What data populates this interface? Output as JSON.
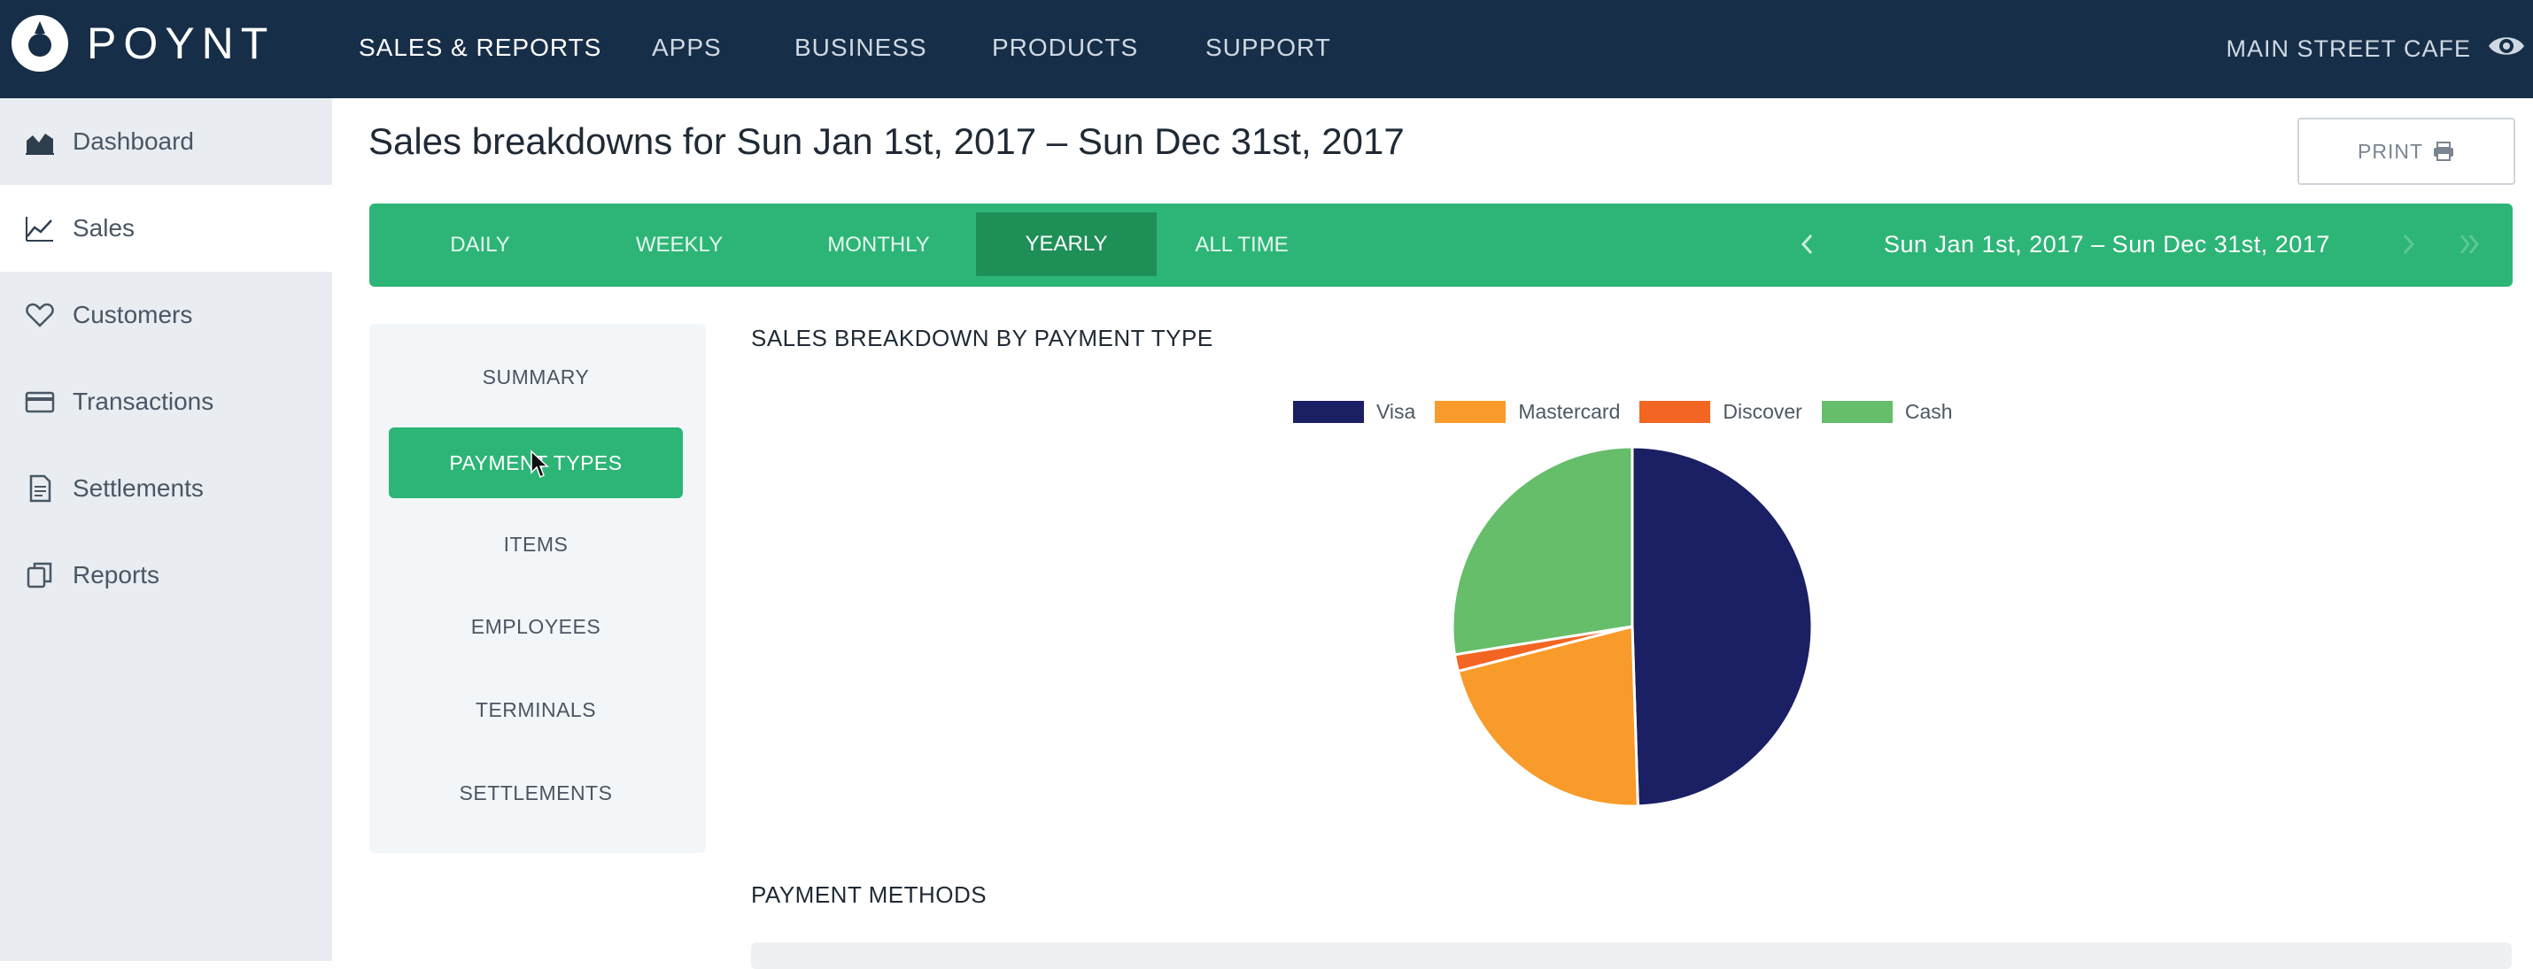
{
  "brand": {
    "name": "POYNT"
  },
  "nav": {
    "items": [
      {
        "label": "SALES & REPORTS",
        "active": true
      },
      {
        "label": "APPS"
      },
      {
        "label": "BUSINESS"
      },
      {
        "label": "PRODUCTS"
      },
      {
        "label": "SUPPORT"
      }
    ],
    "store_name": "MAIN STREET CAFE"
  },
  "sidebar": {
    "items": [
      {
        "label": "Dashboard",
        "icon": "area-chart-icon"
      },
      {
        "label": "Sales",
        "icon": "line-chart-icon",
        "active": true
      },
      {
        "label": "Customers",
        "icon": "heart-icon"
      },
      {
        "label": "Transactions",
        "icon": "credit-card-icon"
      },
      {
        "label": "Settlements",
        "icon": "document-icon"
      },
      {
        "label": "Reports",
        "icon": "copy-icon"
      }
    ]
  },
  "page": {
    "title": "Sales breakdowns for Sun Jan 1st, 2017 – Sun Dec 31st, 2017",
    "print_label": "PRINT"
  },
  "period_tabs": {
    "items": [
      {
        "label": "DAILY"
      },
      {
        "label": "WEEKLY"
      },
      {
        "label": "MONTHLY"
      },
      {
        "label": "YEARLY",
        "active": true
      },
      {
        "label": "ALL TIME"
      }
    ],
    "range": "Sun Jan 1st, 2017 – Sun Dec 31st, 2017"
  },
  "subnav": {
    "items": [
      {
        "label": "SUMMARY"
      },
      {
        "label": "PAYMENT TYPES",
        "active": true
      },
      {
        "label": "ITEMS"
      },
      {
        "label": "EMPLOYEES"
      },
      {
        "label": "TERMINALS"
      },
      {
        "label": "SETTLEMENTS"
      }
    ]
  },
  "sections": {
    "breakdown_heading": "SALES BREAKDOWN BY PAYMENT TYPE",
    "methods_heading": "PAYMENT METHODS"
  },
  "colors": {
    "nav_bg": "#162e47",
    "accent": "#2db577",
    "accent_dark": "#1f8f58"
  },
  "chart_data": {
    "type": "pie",
    "title": "SALES BREAKDOWN BY PAYMENT TYPE",
    "legend_position": "top",
    "series": [
      {
        "name": "Visa",
        "value": 49.5,
        "color": "#1b1f63"
      },
      {
        "name": "Mastercard",
        "value": 21.5,
        "color": "#f99b2a"
      },
      {
        "name": "Discover",
        "value": 1.5,
        "color": "#f26522"
      },
      {
        "name": "Cash",
        "value": 27.5,
        "color": "#66bd6a"
      }
    ]
  }
}
